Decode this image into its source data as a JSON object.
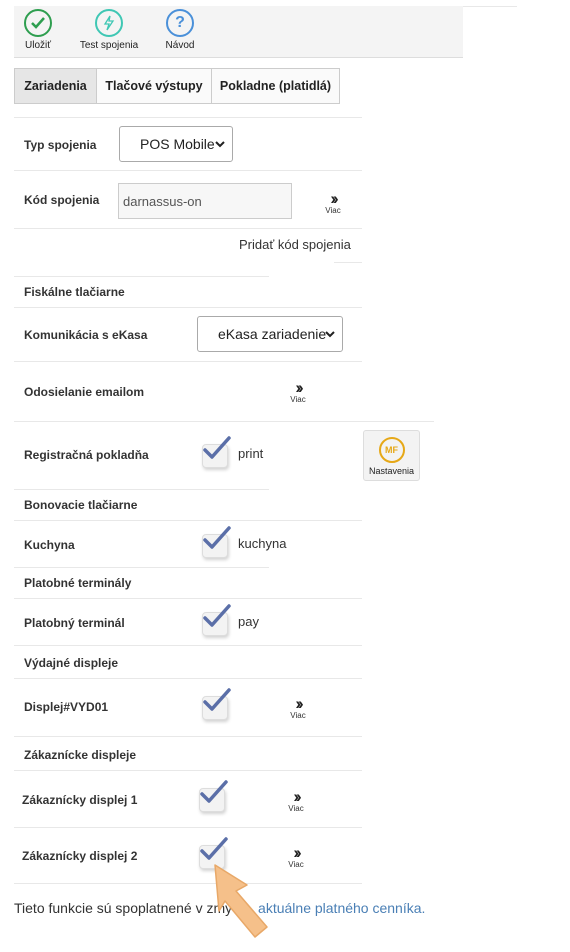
{
  "toolbar": {
    "save_label": "Uložiť",
    "test_label": "Test spojenia",
    "help_label": "Návod",
    "colors": {
      "save": "#2e9e4f",
      "test": "#3fc7b4",
      "help": "#4a90d9"
    }
  },
  "tabs": [
    {
      "label": "Zariadenia",
      "active": true
    },
    {
      "label": "Tlačové výstupy",
      "active": false
    },
    {
      "label": "Pokladne (platidlá)",
      "active": false
    }
  ],
  "connection": {
    "type_label": "Typ spojenia",
    "type_value": "POS Mobile",
    "code_label": "Kód spojenia",
    "code_value": "darnassus-on",
    "more_label": "Viac",
    "add_code_link": "Pridať kód spojenia"
  },
  "fiscal": {
    "section_title": "Fiskálne tlačiarne",
    "ekasa_label": "Komunikácia s eKasa",
    "ekasa_value": "eKasa zariadenie",
    "email_label": "Odosielanie emailom",
    "more_label": "Viac",
    "register_label": "Registračná pokladňa",
    "register_value": "print",
    "register_checked": true,
    "settings_label": "Nastavenia",
    "settings_icon_text": "MF"
  },
  "kitchen": {
    "section_title": "Bonovacie tlačiarne",
    "label": "Kuchyna",
    "value": "kuchyna",
    "checked": true
  },
  "payment": {
    "section_title": "Platobné terminály",
    "label": "Platobný terminál",
    "value": "pay",
    "checked": true
  },
  "dispensing": {
    "section_title": "Výdajné displeje",
    "label": "Displej#VYD01",
    "more_label": "Viac",
    "checked": true
  },
  "customer": {
    "section_title": "Zákaznícke displeje",
    "display1_label": "Zákaznícky displej 1",
    "display2_label": "Zákaznícky displej 2",
    "more_label": "Viac",
    "display1_checked": true,
    "display2_checked": true
  },
  "footer": {
    "text": "Tieto funkcie sú spoplatnené v zmy",
    "link": "aktuálne platného cenníka."
  },
  "colors": {
    "check": "#5b6fa8",
    "link": "#4a7fb5",
    "pointer_arrow": "#f5c08a"
  }
}
